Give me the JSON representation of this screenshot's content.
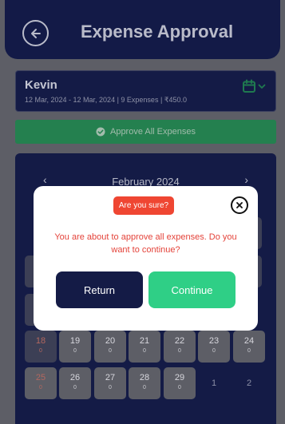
{
  "header": {
    "title": "Expense Approval",
    "back_icon": "arrow-left-icon"
  },
  "user_card": {
    "name": "Kevin",
    "summary": "12 Mar, 2024 - 12 Mar, 2024 | 9 Expenses | ₹450.0",
    "calendar_icon": "calendar-icon",
    "accent_color": "#2fcf86"
  },
  "approve_all": {
    "label": "Approve All Expenses",
    "icon": "check-circle-icon",
    "color": "#24804f"
  },
  "calendar": {
    "month": "February 2024",
    "prev": "‹",
    "next": "›",
    "row_a": [
      {
        "day": "18",
        "count": "0"
      },
      {
        "day": "19",
        "count": "0"
      },
      {
        "day": "20",
        "count": "0"
      },
      {
        "day": "21",
        "count": "0"
      },
      {
        "day": "22",
        "count": "0"
      },
      {
        "day": "23",
        "count": "0"
      },
      {
        "day": "24",
        "count": "0"
      }
    ],
    "row_b": [
      {
        "day": "25",
        "count": "0"
      },
      {
        "day": "26",
        "count": "0"
      },
      {
        "day": "27",
        "count": "0"
      },
      {
        "day": "28",
        "count": "0"
      },
      {
        "day": "29",
        "count": "0"
      },
      {
        "day": "1",
        "count": ""
      },
      {
        "day": "2",
        "count": ""
      }
    ]
  },
  "modal": {
    "badge": "Are you sure?",
    "message": "You are about to approve all expenses. Do you want to continue?",
    "return_label": "Return",
    "continue_label": "Continue",
    "close_icon": "close-icon",
    "badge_color": "#ef4632",
    "primary_color": "#141b46",
    "success_color": "#2fcf86"
  }
}
